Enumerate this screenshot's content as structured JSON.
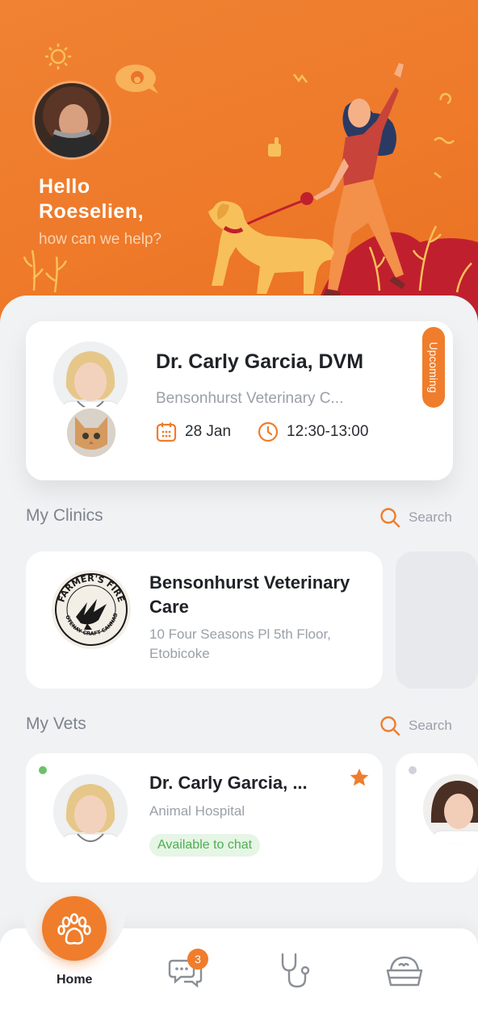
{
  "header": {
    "greeting_line1": "Hello",
    "greeting_line2": "Roeselien,",
    "subtitle": "how can we help?"
  },
  "appointment": {
    "doctor": "Dr. Carly Garcia, DVM",
    "clinic": "Bensonhurst Veterinary C...",
    "date": "28 Jan",
    "time": "12:30-13:00",
    "status": "Upcoming"
  },
  "clinics_section": {
    "title": "My Clinics",
    "search_label": "Search",
    "items": [
      {
        "name": "Bensonhurst Veterinary Care",
        "address": "10 Four Seasons Pl 5th Floor, Etobicoke",
        "logo_text": "FARMER'S FIRE",
        "logo_subtext": "KOOTENAY CRAFT CANNABIS"
      }
    ]
  },
  "vets_section": {
    "title": "My Vets",
    "search_label": "Search",
    "items": [
      {
        "name": "Dr. Carly Garcia, ...",
        "organization": "Animal Hospital",
        "status": "Available to chat",
        "online": true,
        "favorite": true
      }
    ]
  },
  "nav": {
    "home_label": "Home",
    "chat_badge": "3",
    "icons": [
      "paw-icon",
      "chat-icon",
      "stethoscope-icon",
      "pet-bowl-icon"
    ]
  },
  "colors": {
    "accent": "#ef7d2c",
    "hero_bg": "#ee7a2a",
    "online": "#6cc16a",
    "offline": "#cfd3d8"
  }
}
